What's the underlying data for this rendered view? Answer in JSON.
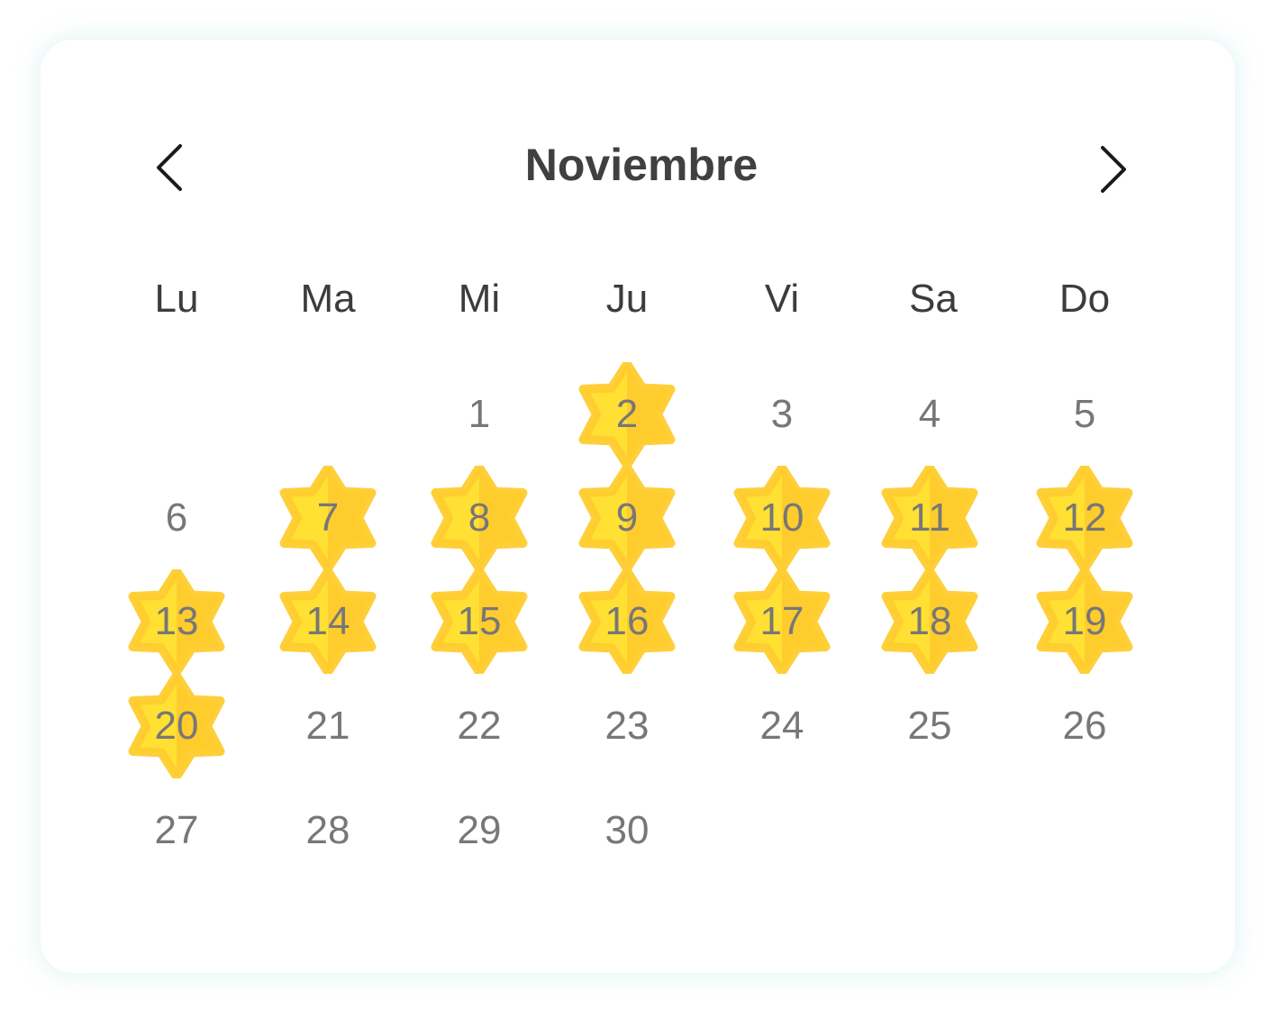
{
  "calendar": {
    "month": "Noviembre",
    "weekdays": [
      "Lu",
      "Ma",
      "Mi",
      "Ju",
      "Vi",
      "Sa",
      "Do"
    ],
    "days": [
      {
        "day": "1",
        "highlighted": false
      },
      {
        "day": "2",
        "highlighted": true
      },
      {
        "day": "3",
        "highlighted": false
      },
      {
        "day": "4",
        "highlighted": false
      },
      {
        "day": "5",
        "highlighted": false
      },
      {
        "day": "6",
        "highlighted": false
      },
      {
        "day": "7",
        "highlighted": true
      },
      {
        "day": "8",
        "highlighted": true
      },
      {
        "day": "9",
        "highlighted": true
      },
      {
        "day": "10",
        "highlighted": true
      },
      {
        "day": "11",
        "highlighted": true
      },
      {
        "day": "12",
        "highlighted": true
      },
      {
        "day": "13",
        "highlighted": true
      },
      {
        "day": "14",
        "highlighted": true
      },
      {
        "day": "15",
        "highlighted": true
      },
      {
        "day": "16",
        "highlighted": true
      },
      {
        "day": "17",
        "highlighted": true
      },
      {
        "day": "18",
        "highlighted": true
      },
      {
        "day": "19",
        "highlighted": true
      },
      {
        "day": "20",
        "highlighted": true
      },
      {
        "day": "21",
        "highlighted": false
      },
      {
        "day": "22",
        "highlighted": false
      },
      {
        "day": "23",
        "highlighted": false
      },
      {
        "day": "24",
        "highlighted": false
      },
      {
        "day": "25",
        "highlighted": false
      },
      {
        "day": "26",
        "highlighted": false
      },
      {
        "day": "27",
        "highlighted": false
      },
      {
        "day": "28",
        "highlighted": false
      },
      {
        "day": "29",
        "highlighted": false
      },
      {
        "day": "30",
        "highlighted": false
      }
    ]
  },
  "colors": {
    "star_left": "#FFE033",
    "star_right": "#FFCC2E",
    "day_text": "#777777",
    "title_text": "#404040",
    "arrow": "#1a1a1a"
  },
  "icons": {
    "prev": "chevron-left-icon",
    "next": "chevron-right-icon",
    "highlight": "star-icon"
  }
}
